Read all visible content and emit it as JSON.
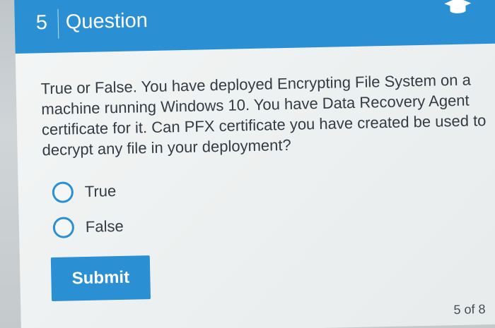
{
  "header": {
    "question_number": "5",
    "title": "Question",
    "icon": "graduation-cap-icon"
  },
  "question": {
    "text": "True or False. You have deployed Encrypting File System on a machine running Windows 10. You have Data Recovery Agent certificate for it. Can PFX certificate you have created be used to decrypt any file in your deployment?"
  },
  "options": [
    {
      "label": "True",
      "selected": false
    },
    {
      "label": "False",
      "selected": false
    }
  ],
  "submit": {
    "label": "Submit"
  },
  "footer": {
    "page_counter": "5 of 8"
  },
  "colors": {
    "accent": "#2b8fd4",
    "text": "#333c44",
    "card_background": "#f1f3f3"
  }
}
